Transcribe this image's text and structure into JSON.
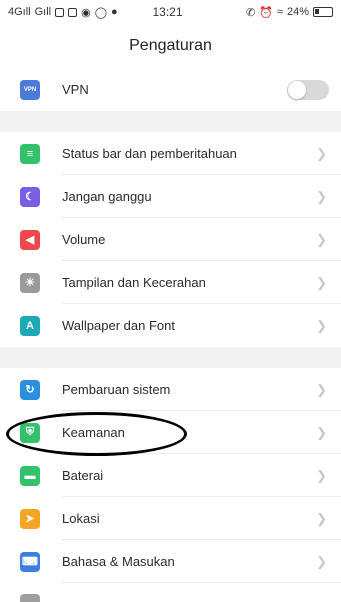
{
  "status_bar": {
    "signal_left": "4Gıll",
    "signal_right": "Gıll",
    "time": "13:21",
    "battery": "24%"
  },
  "header": {
    "title": "Pengaturan"
  },
  "sections": [
    {
      "items": [
        {
          "label": "VPN",
          "icon": "vpn-icon",
          "color": "#4a7bd6",
          "glyph": "VPN",
          "toggle": false
        }
      ]
    },
    {
      "items": [
        {
          "label": "Status bar dan pemberitahuan",
          "icon": "notification-icon",
          "color": "#33c26b",
          "glyph": "≡"
        },
        {
          "label": "Jangan ganggu",
          "icon": "moon-icon",
          "color": "#7b5ce6",
          "glyph": "☾"
        },
        {
          "label": "Volume",
          "icon": "speaker-icon",
          "color": "#f0474d",
          "glyph": "◀"
        },
        {
          "label": "Tampilan dan Kecerahan",
          "icon": "sun-icon",
          "color": "#9a9a9a",
          "glyph": "☀"
        },
        {
          "label": "Wallpaper dan Font",
          "icon": "font-icon",
          "color": "#1aa9b5",
          "glyph": "A"
        }
      ]
    },
    {
      "items": [
        {
          "label": "Pembaruan sistem",
          "icon": "update-icon",
          "color": "#2c8ee0",
          "glyph": "↻"
        },
        {
          "label": "Keamanan",
          "icon": "shield-icon",
          "color": "#33c26b",
          "glyph": "⛨"
        },
        {
          "label": "Baterai",
          "icon": "battery-icon",
          "color": "#33c26b",
          "glyph": "▬"
        },
        {
          "label": "Lokasi",
          "icon": "location-icon",
          "color": "#f5a524",
          "glyph": "➤"
        },
        {
          "label": "Bahasa & Masukan",
          "icon": "keyboard-icon",
          "color": "#3d7fe0",
          "glyph": "⌨"
        }
      ]
    }
  ]
}
